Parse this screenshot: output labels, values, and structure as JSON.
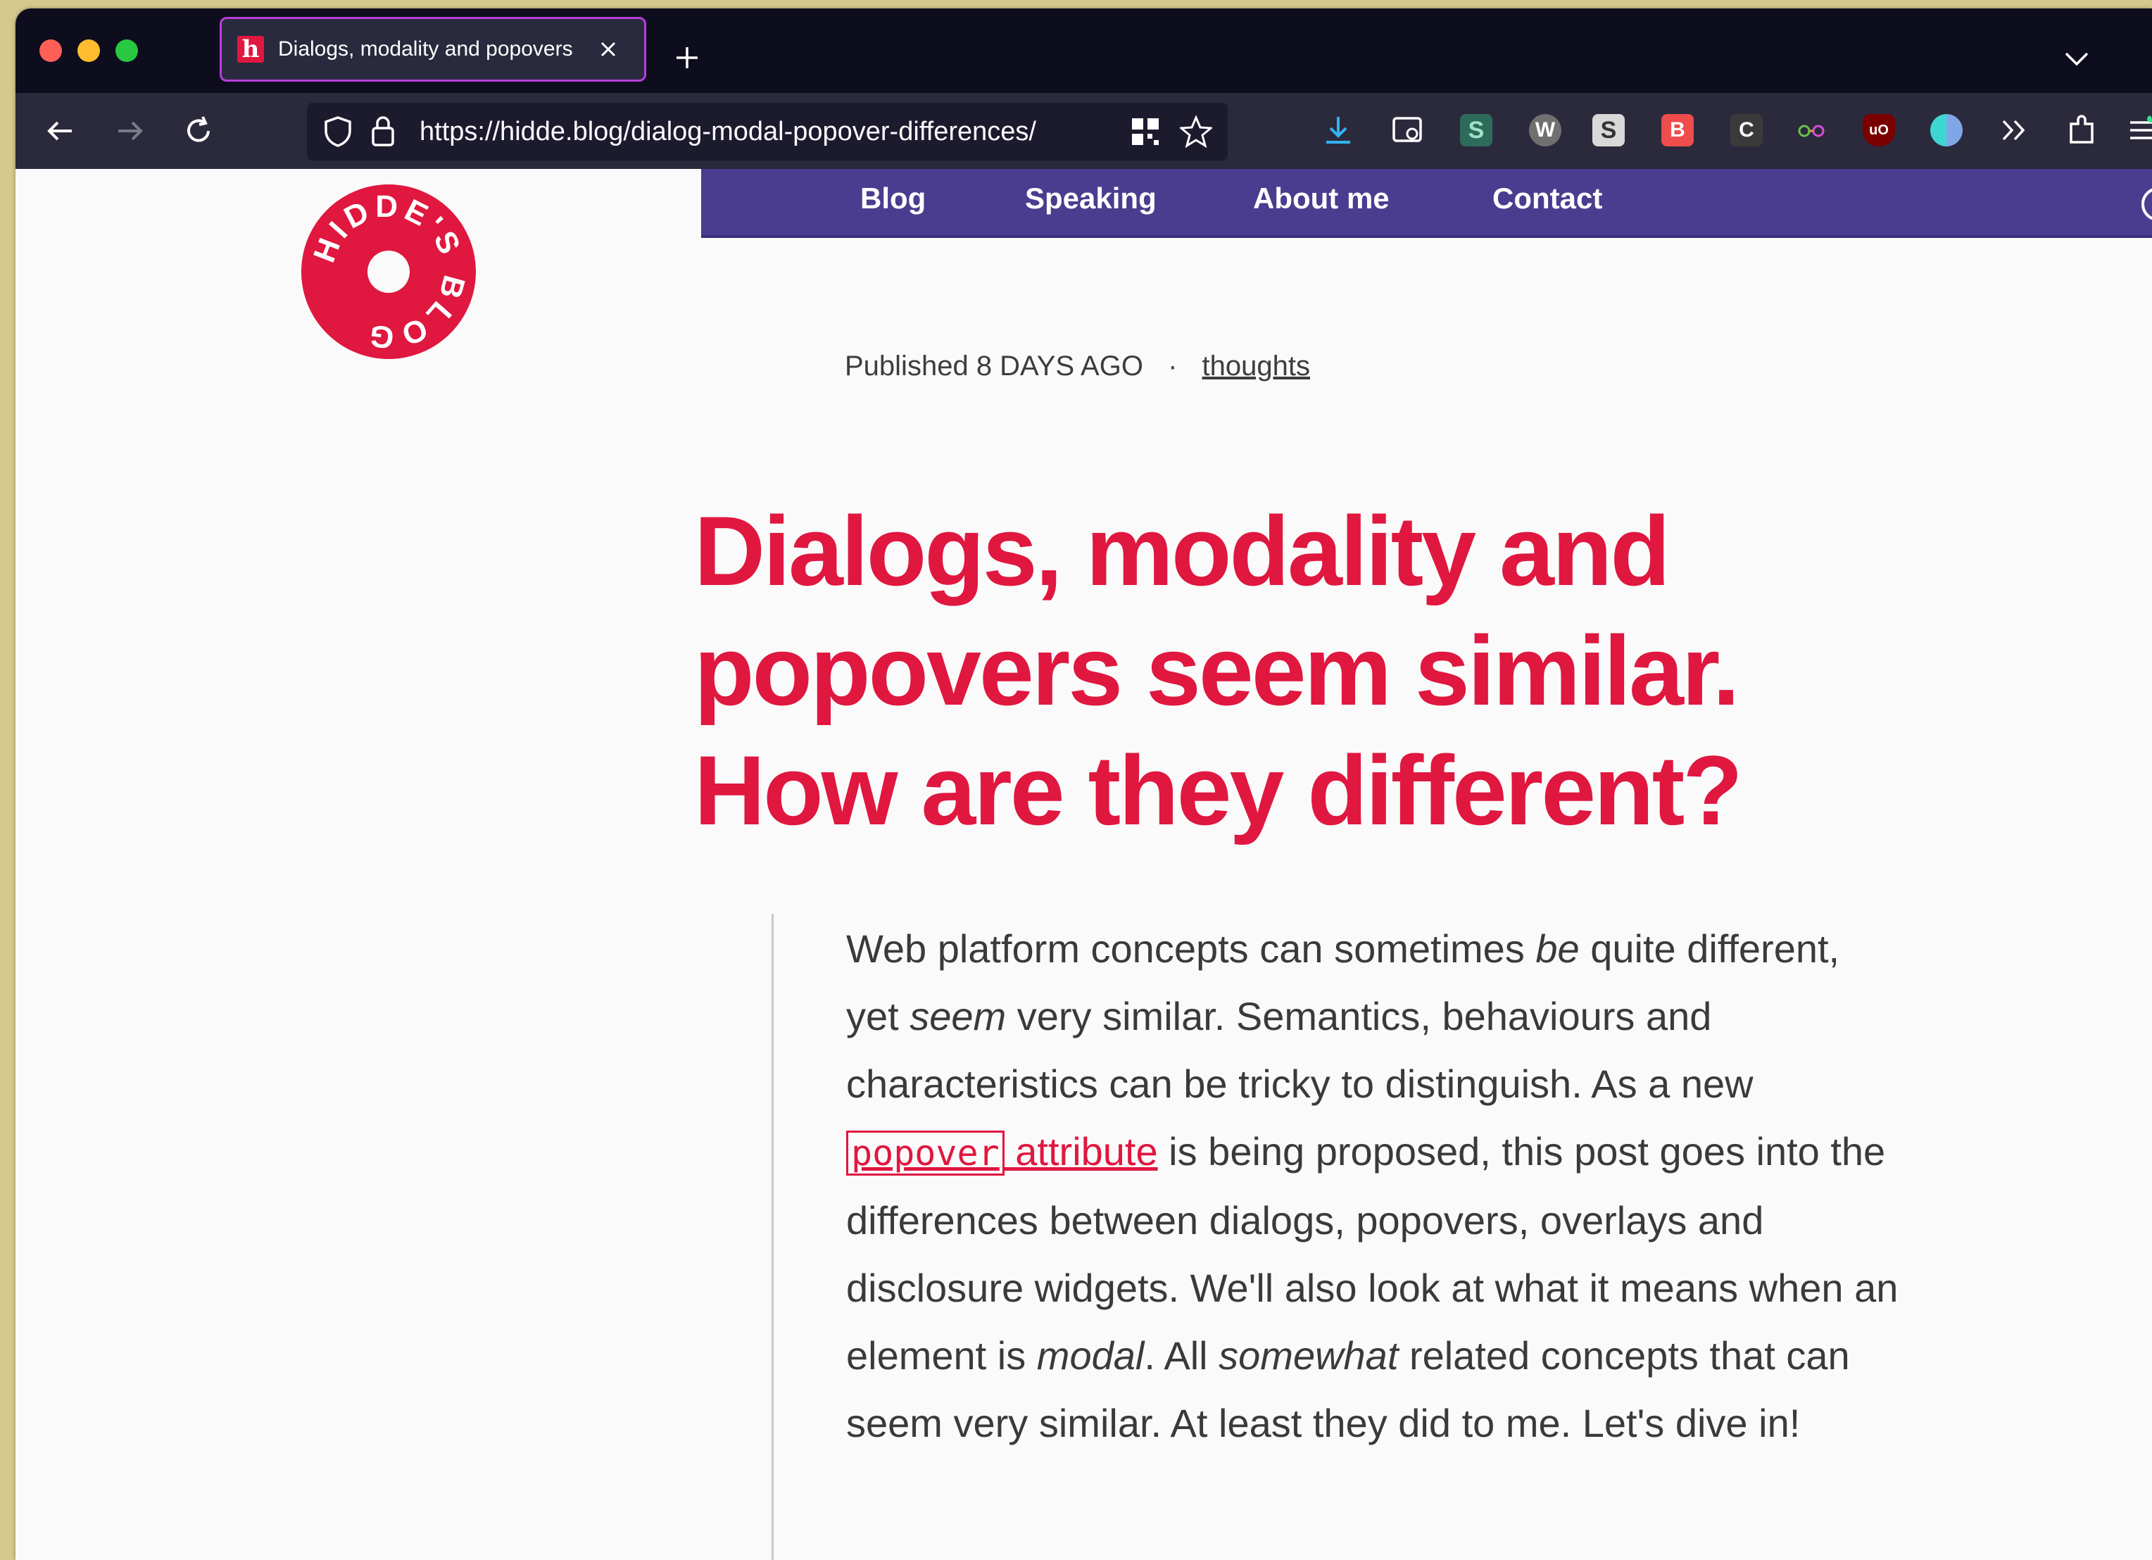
{
  "browser": {
    "tab_title": "Dialogs, modality and popovers",
    "favicon_letter": "h",
    "url": "https://hidde.blog/dialog-modal-popover-differences/",
    "extensions": [
      "download-icon",
      "reader-icon",
      "s-extension-icon",
      "w-extension-icon",
      "s-grey-extension-icon",
      "b-extension-icon",
      "c-extension-icon",
      "glasses-extension-icon",
      "ublock-icon",
      "circle-extension-icon",
      "overflow-icon",
      "puzzle-icon",
      "menu-icon"
    ]
  },
  "site": {
    "logo_text": "HIDDE'S BLOG",
    "nav": [
      "Blog",
      "Speaking",
      "About me",
      "Contact"
    ],
    "accent_color": "#e0173f",
    "nav_color": "#4a3d8f"
  },
  "article": {
    "published_prefix": "Published",
    "published_when": "8 DAYS AGO",
    "separator": "·",
    "category": "thoughts",
    "title": "Dialogs, modality and popovers seem similar. How are they different?",
    "intro": {
      "p1": "Web platform concepts can sometimes ",
      "em1": "be",
      "p2": " quite different, yet ",
      "em2": "seem",
      "p3": " very similar. Semantics, behaviours and characteristics can be tricky to distinguish. As a new ",
      "code": "popover",
      "link_rest": " attribute",
      "p4": " is being proposed, this post goes into the differences between dialogs, popovers, overlays and disclosure widgets. We'll also look at what it means when an element is ",
      "em3": "modal",
      "p5": ". All ",
      "em4": "somewhat",
      "p6": " related concepts that can seem very similar. At least they did to me. Let's dive in!"
    }
  }
}
